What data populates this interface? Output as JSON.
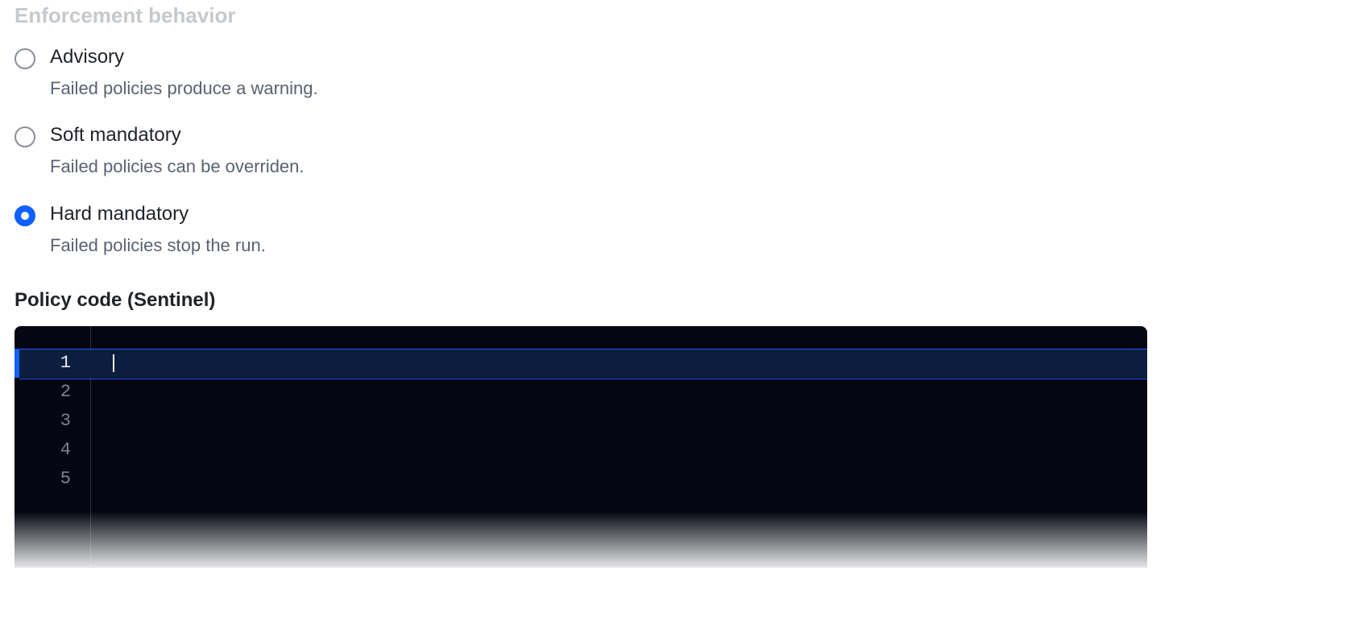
{
  "section": {
    "title": "Enforcement behavior"
  },
  "options": [
    {
      "label": "Advisory",
      "description": "Failed policies produce a warning.",
      "selected": false
    },
    {
      "label": "Soft mandatory",
      "description": "Failed policies can be overriden.",
      "selected": false
    },
    {
      "label": "Hard mandatory",
      "description": "Failed policies stop the run.",
      "selected": true
    }
  ],
  "editor": {
    "heading": "Policy code (Sentinel)",
    "active_line": 1,
    "lines": [
      {
        "n": "1",
        "content": ""
      },
      {
        "n": "2",
        "content": ""
      },
      {
        "n": "3",
        "content": ""
      },
      {
        "n": "4",
        "content": ""
      },
      {
        "n": "5",
        "content": ""
      }
    ]
  }
}
